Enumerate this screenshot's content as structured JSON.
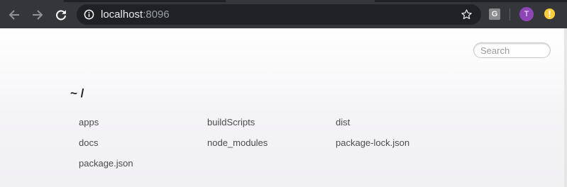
{
  "browser": {
    "back_icon": "arrow-left-icon",
    "forward_icon": "arrow-right-icon",
    "reload_icon": "reload-icon",
    "address": {
      "host": "localhost",
      "port": ":8096",
      "info_icon": "info-icon",
      "bookmark_icon": "star-icon"
    },
    "extension_label": "G",
    "profile_initial": "T",
    "profile_color": "#8e45b6",
    "alert_icon": "alert-icon",
    "alert_color": "#f9cc3c"
  },
  "page": {
    "search_placeholder": "Search",
    "path": "~ /",
    "files": [
      {
        "name": "apps"
      },
      {
        "name": "buildScripts"
      },
      {
        "name": "dist"
      },
      {
        "name": "docs"
      },
      {
        "name": "node_modules"
      },
      {
        "name": "package-lock.json"
      },
      {
        "name": "package.json"
      }
    ]
  }
}
